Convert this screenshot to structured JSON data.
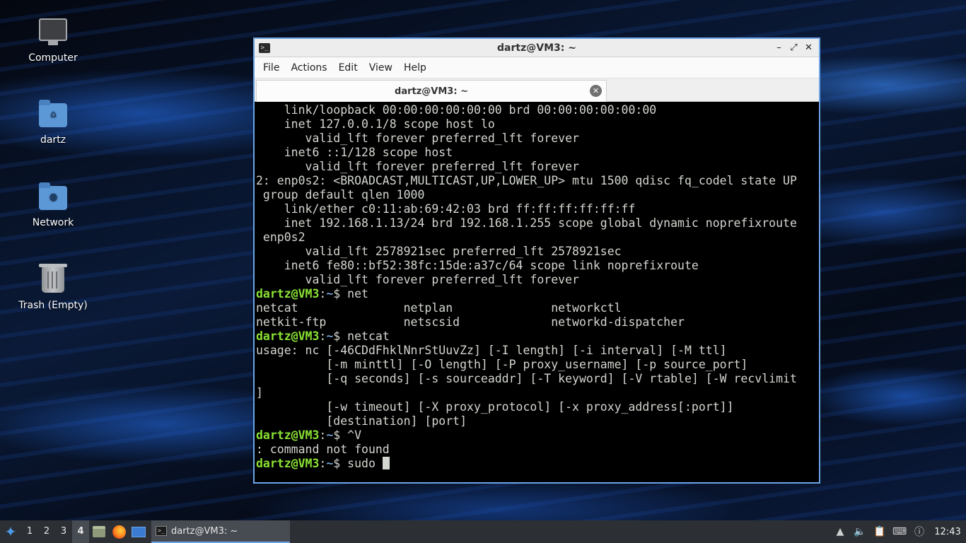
{
  "desktop": {
    "icons": [
      {
        "label": "Computer",
        "icon": "computer-icon"
      },
      {
        "label": "dartz",
        "icon": "home-folder-icon"
      },
      {
        "label": "Network",
        "icon": "network-folder-icon"
      },
      {
        "label": "Trash (Empty)",
        "icon": "trash-icon"
      }
    ]
  },
  "window": {
    "title": "dartz@VM3: ~",
    "controls": {
      "minimize": "–",
      "maximize": "⤢",
      "close": "✕"
    },
    "menu": [
      "File",
      "Actions",
      "Edit",
      "View",
      "Help"
    ],
    "tab": {
      "label": "dartz@VM3: ~",
      "close": "✕"
    }
  },
  "terminal": {
    "prompt": {
      "user_host": "dartz@VM3",
      "sep": ":",
      "path": "~",
      "symbol": "$ "
    },
    "lines": [
      "    link/loopback 00:00:00:00:00:00 brd 00:00:00:00:00:00",
      "    inet 127.0.0.1/8 scope host lo",
      "       valid_lft forever preferred_lft forever",
      "    inet6 ::1/128 scope host",
      "       valid_lft forever preferred_lft forever",
      "2: enp0s2: <BROADCAST,MULTICAST,UP,LOWER_UP> mtu 1500 qdisc fq_codel state UP",
      " group default qlen 1000",
      "    link/ether c0:11:ab:69:42:03 brd ff:ff:ff:ff:ff:ff",
      "    inet 192.168.1.13/24 brd 192.168.1.255 scope global dynamic noprefixroute",
      " enp0s2",
      "       valid_lft 2578921sec preferred_lft 2578921sec",
      "    inet6 fe80::bf52:38fc:15de:a37c/64 scope link noprefixroute",
      "       valid_lft forever preferred_lft forever",
      {
        "prompt": true,
        "cmd": "net"
      },
      "netcat               netplan              networkctl",
      "netkit-ftp           netscsid             networkd-dispatcher",
      {
        "prompt": true,
        "cmd": "netcat"
      },
      "usage: nc [-46CDdFhklNnrStUuvZz] [-I length] [-i interval] [-M ttl]",
      "          [-m minttl] [-O length] [-P proxy_username] [-p source_port]",
      "          [-q seconds] [-s sourceaddr] [-T keyword] [-V rtable] [-W recvlimit",
      "]",
      "          [-w timeout] [-X proxy_protocol] [-x proxy_address[:port]]",
      "          [destination] [port]",
      {
        "prompt": true,
        "cmd": "^V"
      },
      ": command not found",
      {
        "prompt": true,
        "cmd": "sudo ",
        "cursor": true
      }
    ]
  },
  "taskbar": {
    "workspaces": [
      "1",
      "2",
      "3",
      "4"
    ],
    "active_workspace": "4",
    "task": {
      "label": "dartz@VM3: ~"
    },
    "clock": "12:43"
  }
}
